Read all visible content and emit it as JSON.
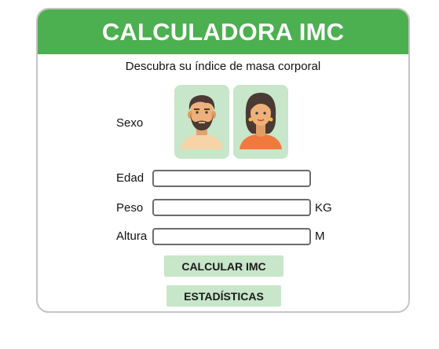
{
  "header": {
    "title": "CALCULADORA IMC"
  },
  "subtitle": "Descubra su índice de masa corporal",
  "sex": {
    "label": "Sexo",
    "options": [
      {
        "name": "male-avatar-icon"
      },
      {
        "name": "female-avatar-icon"
      }
    ]
  },
  "form": {
    "age_label": "Edad",
    "age_value": "",
    "weight_label": "Peso",
    "weight_value": "",
    "weight_unit": "KG",
    "height_label": "Altura",
    "height_value": "",
    "height_unit": "M"
  },
  "buttons": {
    "calculate": "CALCULAR IMC",
    "stats": "ESTADÍSTICAS"
  },
  "colors": {
    "header": "#4caf50",
    "button_bg": "#c8e6c9",
    "border": "#c4c4c4"
  }
}
